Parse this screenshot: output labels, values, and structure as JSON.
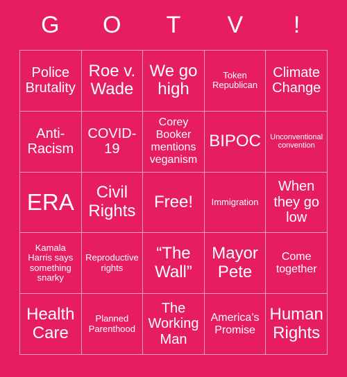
{
  "card": {
    "background_color": "#e61e5f",
    "text_color": "#ffffff",
    "border_color": "#f2a2b9"
  },
  "header": {
    "letters": [
      "G",
      "O",
      "T",
      "V",
      "!"
    ]
  },
  "grid": {
    "rows": [
      [
        {
          "text": "Police Brutality",
          "size": "fs-md"
        },
        {
          "text": "Roe v. Wade",
          "size": "fs-lg"
        },
        {
          "text": "We go high",
          "size": "fs-lg"
        },
        {
          "text": "Token Republican",
          "size": "fs-xs"
        },
        {
          "text": "Climate Change",
          "size": "fs-md"
        }
      ],
      [
        {
          "text": "Anti-Racism",
          "size": "fs-md"
        },
        {
          "text": "COVID-19",
          "size": "fs-md"
        },
        {
          "text": "Corey Booker mentions veganism",
          "size": "fs-sm"
        },
        {
          "text": "BIPOC",
          "size": "fs-lg"
        },
        {
          "text": "Unconventional convention",
          "size": "fs-xxs"
        }
      ],
      [
        {
          "text": "ERA",
          "size": "fs-xl"
        },
        {
          "text": "Civil Rights",
          "size": "fs-lg"
        },
        {
          "text": "Free!",
          "size": "fs-lg"
        },
        {
          "text": "Immigration",
          "size": "fs-xs"
        },
        {
          "text": "When they go low",
          "size": "fs-md"
        }
      ],
      [
        {
          "text": "Kamala Harris says something snarky",
          "size": "fs-xs"
        },
        {
          "text": "Reproductive rights",
          "size": "fs-xs"
        },
        {
          "text": "“The Wall”",
          "size": "fs-lg"
        },
        {
          "text": "Mayor Pete",
          "size": "fs-lg"
        },
        {
          "text": "Come together",
          "size": "fs-sm"
        }
      ],
      [
        {
          "text": "Health Care",
          "size": "fs-lg"
        },
        {
          "text": "Planned Parenthood",
          "size": "fs-xs"
        },
        {
          "text": "The Working Man",
          "size": "fs-md"
        },
        {
          "text": "America’s Promise",
          "size": "fs-sm"
        },
        {
          "text": "Human Rights",
          "size": "fs-lg"
        }
      ]
    ]
  }
}
